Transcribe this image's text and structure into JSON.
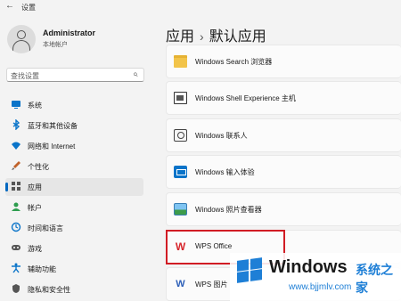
{
  "window": {
    "title": "设置",
    "back_glyph": "←"
  },
  "profile": {
    "name": "Administrator",
    "account_type": "本地帐户"
  },
  "search": {
    "placeholder": "查找设置",
    "icon": "search-icon"
  },
  "sidebar": {
    "items": [
      {
        "label": "系统",
        "icon": "monitor-icon",
        "color": "#0a74c9",
        "active": false
      },
      {
        "label": "蓝牙和其他设备",
        "icon": "bluetooth-icon",
        "color": "#0a74c9",
        "active": false
      },
      {
        "label": "网络和 Internet",
        "icon": "wifi-icon",
        "color": "#0a74c9",
        "active": false
      },
      {
        "label": "个性化",
        "icon": "brush-icon",
        "color": "#c0622b",
        "active": false
      },
      {
        "label": "应用",
        "icon": "apps-icon",
        "color": "#555555",
        "active": true
      },
      {
        "label": "帐户",
        "icon": "person-icon",
        "color": "#2e9d4f",
        "active": false
      },
      {
        "label": "时间和语言",
        "icon": "globe-clock-icon",
        "color": "#0a74c9",
        "active": false
      },
      {
        "label": "游戏",
        "icon": "gamepad-icon",
        "color": "#555555",
        "active": false
      },
      {
        "label": "辅助功能",
        "icon": "accessibility-icon",
        "color": "#0a74c9",
        "active": false
      },
      {
        "label": "隐私和安全性",
        "icon": "shield-icon",
        "color": "#555555",
        "active": false
      }
    ]
  },
  "breadcrumb": {
    "parent": "应用",
    "separator": "›",
    "current": "默认应用"
  },
  "apps": [
    {
      "label": "Windows Search 浏览器",
      "icon": "folder-icon"
    },
    {
      "label": "Windows Shell Experience 主机",
      "icon": "shell-window-icon"
    },
    {
      "label": "Windows 联系人",
      "icon": "contacts-icon"
    },
    {
      "label": "Windows 输入体验",
      "icon": "keyboard-icon"
    },
    {
      "label": "Windows 照片查看器",
      "icon": "photo-icon"
    },
    {
      "label": "WPS Office",
      "icon": "wps-office-icon",
      "logo_text": "W"
    },
    {
      "label": "WPS 图片",
      "icon": "wps-picture-icon",
      "logo_text": "W"
    }
  ],
  "highlight": {
    "color": "#d11c24"
  },
  "watermark": {
    "brand": "Windows",
    "cn": "系统之家",
    "url": "www.bjjmlv.com"
  }
}
